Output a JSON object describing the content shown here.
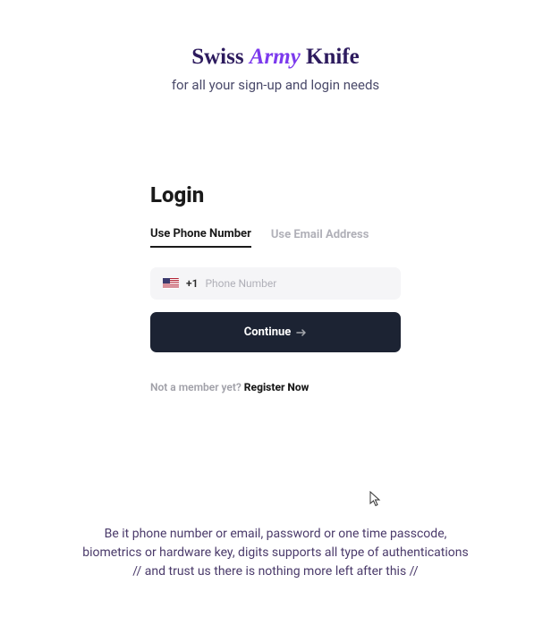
{
  "hero": {
    "title_part1": "Swiss ",
    "title_emphasis": "Army",
    "title_part2": " Knife",
    "subtitle": "for all your sign-up and login needs"
  },
  "login": {
    "heading": "Login",
    "tabs": {
      "phone": "Use Phone Number",
      "email": "Use Email Address"
    },
    "country_code": "+1",
    "phone_placeholder": "Phone Number",
    "continue_label": "Continue"
  },
  "footer": {
    "prompt": "Not a member yet? ",
    "register_label": "Register Now"
  },
  "bottom": {
    "line1": "Be it phone number or email, password or one time passcode,",
    "line2": "biometrics or hardware key, digits supports all type of authentications",
    "line3": "// and trust us there is nothing more left after this //"
  }
}
